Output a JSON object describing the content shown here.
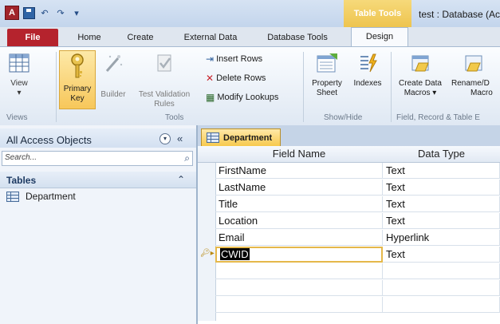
{
  "qat": {
    "undo": "↶",
    "redo": "↷",
    "customize": "▾"
  },
  "context": {
    "title": "Table Tools",
    "color": "#f0c752"
  },
  "window_title": "test : Database (Ac",
  "tabs": [
    "Home",
    "Create",
    "External Data",
    "Database Tools"
  ],
  "file_tab": "File",
  "design_tab": "Design",
  "ribbon": {
    "view": {
      "label": "View",
      "caret": "▾"
    },
    "primary_key": {
      "line1": "Primary",
      "line2": "Key"
    },
    "builder": "Builder",
    "test_validation": {
      "line1": "Test Validation",
      "line2": "Rules"
    },
    "insert_rows": "Insert Rows",
    "delete_rows": "Delete Rows",
    "modify_lookups": "Modify Lookups",
    "property_sheet": {
      "line1": "Property",
      "line2": "Sheet"
    },
    "indexes": "Indexes",
    "create_data_macros": {
      "line1": "Create Data",
      "line2": "Macros ▾"
    },
    "rename_delete_macro": {
      "line1": "Rename/D",
      "line2": "Macro"
    },
    "groups": {
      "views": "Views",
      "tools": "Tools",
      "show_hide": "Show/Hide",
      "field_record": "Field, Record & Table E"
    }
  },
  "nav": {
    "title": "All Access Objects",
    "collapse": "«",
    "search_placeholder": "Search...",
    "section": "Tables",
    "section_chevron": "⌃",
    "items": [
      {
        "label": "Department"
      }
    ]
  },
  "doc": {
    "tab": "Department",
    "columns": [
      "Field Name",
      "Data Type"
    ],
    "rows": [
      {
        "field": "FirstName",
        "type": "Text"
      },
      {
        "field": "LastName",
        "type": "Text"
      },
      {
        "field": "Title",
        "type": "Text"
      },
      {
        "field": "Location",
        "type": "Text"
      },
      {
        "field": "Email",
        "type": "Hyperlink"
      },
      {
        "field": "CWID",
        "type": "Text",
        "current": true
      }
    ]
  }
}
